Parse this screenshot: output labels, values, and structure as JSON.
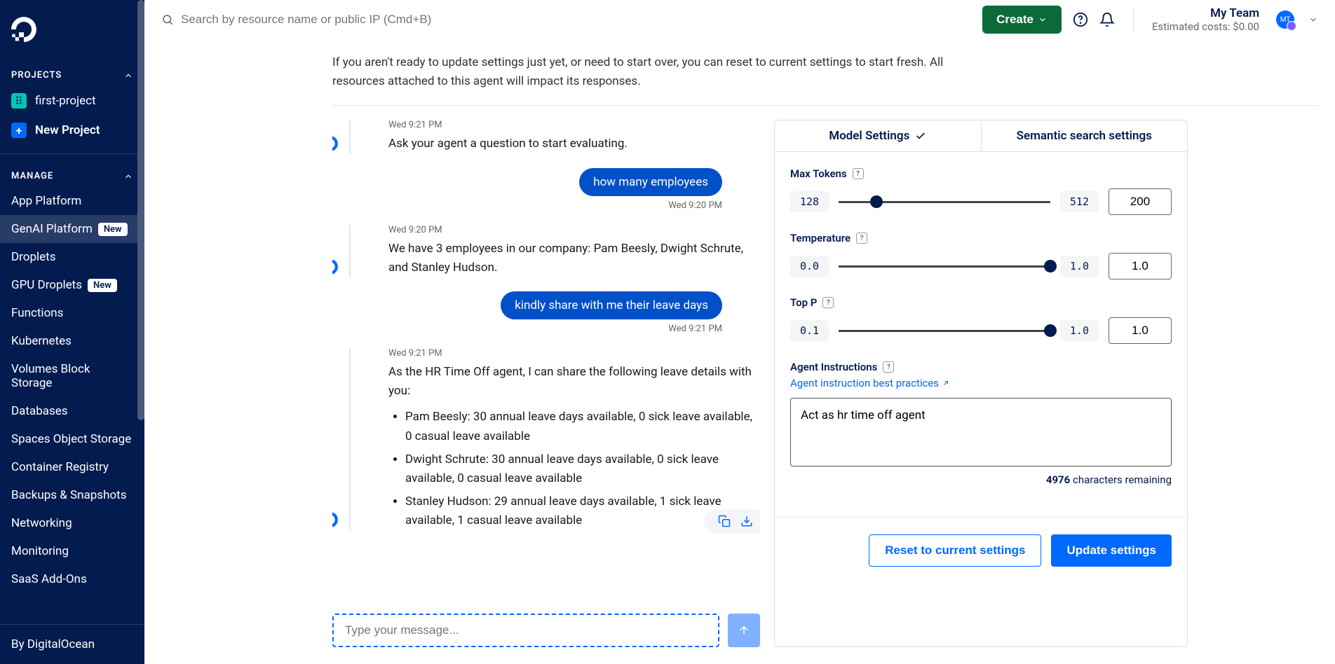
{
  "header": {
    "search_placeholder": "Search by resource name or public IP (Cmd+B)",
    "create_label": "Create",
    "team_name": "My Team",
    "cost_line": "Estimated costs: $0.00",
    "avatar_initials": "MT"
  },
  "sidebar": {
    "projects_header": "PROJECTS",
    "manage_header": "MANAGE",
    "items_projects": [
      {
        "label": "first-project"
      },
      {
        "label": "New Project"
      }
    ],
    "items_manage": [
      {
        "label": "App Platform",
        "active": false,
        "badge": ""
      },
      {
        "label": "GenAI Platform",
        "active": true,
        "badge": "New"
      },
      {
        "label": "Droplets",
        "active": false,
        "badge": ""
      },
      {
        "label": "GPU Droplets",
        "active": false,
        "badge": "New"
      },
      {
        "label": "Functions",
        "active": false,
        "badge": ""
      },
      {
        "label": "Kubernetes",
        "active": false,
        "badge": ""
      },
      {
        "label": "Volumes Block Storage",
        "active": false,
        "badge": ""
      },
      {
        "label": "Databases",
        "active": false,
        "badge": ""
      },
      {
        "label": "Spaces Object Storage",
        "active": false,
        "badge": ""
      },
      {
        "label": "Container Registry",
        "active": false,
        "badge": ""
      },
      {
        "label": "Backups & Snapshots",
        "active": false,
        "badge": ""
      },
      {
        "label": "Networking",
        "active": false,
        "badge": ""
      },
      {
        "label": "Monitoring",
        "active": false,
        "badge": ""
      },
      {
        "label": "SaaS Add-Ons",
        "active": false,
        "badge": ""
      }
    ],
    "footer": "By DigitalOcean"
  },
  "info_text": "If you aren't ready to update settings just yet, or need to start over, you can reset to current settings to start fresh. All resources attached to this agent will impact its responses.",
  "chat": {
    "messages": [
      {
        "kind": "agent",
        "time": "Wed 9:21 PM",
        "text": "Ask your agent a question to start evaluating."
      },
      {
        "kind": "user",
        "time": "Wed 9:20 PM",
        "text": "how many employees"
      },
      {
        "kind": "agent",
        "time": "Wed 9:20 PM",
        "text": "We have 3 employees in our company: Pam Beesly, Dwight Schrute, and Stanley Hudson."
      },
      {
        "kind": "user",
        "time": "Wed 9:21 PM",
        "text": "kindly share with me their leave days"
      },
      {
        "kind": "agent",
        "time": "Wed 9:21 PM",
        "text": "As the HR Time Off agent, I can share the following leave details with you:",
        "list": [
          "Pam Beesly: 30 annual leave days available, 0 sick leave available, 0 casual leave available",
          "Dwight Schrute: 30 annual leave days available, 0 sick leave available, 0 casual leave available",
          "Stanley Hudson: 29 annual leave days available, 1 sick leave available, 1 casual leave available"
        ]
      }
    ],
    "input_placeholder": "Type your message..."
  },
  "settings": {
    "tabs": [
      "Model Settings",
      "Semantic search settings"
    ],
    "max_tokens": {
      "label": "Max Tokens",
      "min": "128",
      "max": "512",
      "value": "200",
      "thumb_pct": 18
    },
    "temperature": {
      "label": "Temperature",
      "min": "0.0",
      "max": "1.0",
      "value": "1.0",
      "thumb_pct": 100
    },
    "top_p": {
      "label": "Top P",
      "min": "0.1",
      "max": "1.0",
      "value": "1.0",
      "thumb_pct": 100
    },
    "instructions_label": "Agent Instructions",
    "instructions_link": "Agent instruction best practices",
    "instructions_value": "Act as hr time off agent",
    "char_count": "4976",
    "char_suffix": "characters remaining",
    "reset_label": "Reset to current settings",
    "update_label": "Update settings"
  }
}
